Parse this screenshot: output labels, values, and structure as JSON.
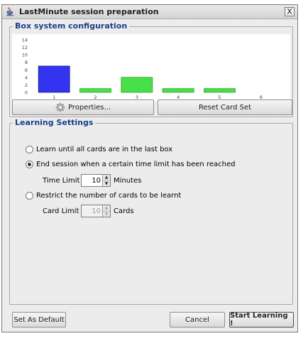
{
  "window": {
    "title": "LastMinute session preparation",
    "close_label": "X"
  },
  "box_system": {
    "title": "Box system configuration"
  },
  "chart_data": {
    "type": "bar",
    "title": "",
    "xlabel": "",
    "ylabel": "",
    "categories": [
      "1",
      "2",
      "3",
      "4",
      "5",
      "6"
    ],
    "values": [
      7,
      1,
      4,
      1,
      1,
      0
    ],
    "yticks": [
      "0",
      "2",
      "4",
      "6",
      "8",
      "10",
      "12",
      "14"
    ],
    "ylim": [
      0,
      14
    ],
    "colors": [
      "#3434f0",
      "#48e048",
      "#48e048",
      "#48e048",
      "#48e048",
      "#48e048"
    ],
    "grid": false,
    "legend": "none"
  },
  "buttons": {
    "properties": "Properties...",
    "reset": "Reset Card Set",
    "set_default": "Set As Default",
    "cancel": "Cancel",
    "start": "Start Learning !"
  },
  "learning": {
    "title": "Learning Settings",
    "option_last_box": "Learn until all cards are in the last box",
    "option_time_limit": "End session when a certain time limit has been reached",
    "time_limit_label": "Time Limit :",
    "time_limit_value": "10",
    "time_limit_unit": "Minutes",
    "option_card_limit": "Restrict the number of cards to be learnt",
    "card_limit_label": "Card Limit :",
    "card_limit_value": "10",
    "card_limit_unit": "Cards",
    "selected_option": "time_limit"
  },
  "icons": {
    "app": "java-cup-icon",
    "properties": "gear-icon",
    "spinner_up": "arrow-up-icon",
    "spinner_down": "arrow-down-icon"
  }
}
